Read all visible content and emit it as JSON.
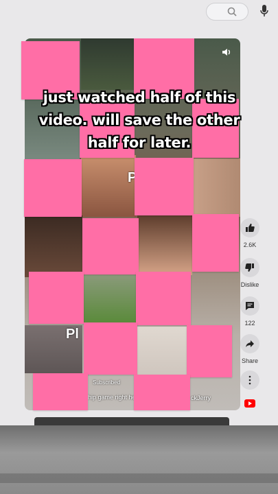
{
  "caption": {
    "line1": "just watched half of this",
    "line2": "video. will save the other",
    "line3": "half for later."
  },
  "video": {
    "subscribed_label": "Subscribed",
    "title_fragment": "hip game right he",
    "channel_fragment": "ckJerry",
    "overlay_letter_1": "P",
    "overlay_letters_2": "Pl"
  },
  "actions": {
    "likes": "2.6K",
    "dislike_label": "Dislike",
    "comments": "122",
    "share_label": "Share"
  },
  "icons": {
    "search": "search-icon",
    "mic": "mic-icon",
    "volume": "volume-icon",
    "like": "thumbs-up-icon",
    "dislike": "thumbs-down-icon",
    "comment": "comment-icon",
    "share": "share-icon",
    "more": "more-vertical-icon",
    "youtube": "youtube-logo-icon"
  },
  "colors": {
    "sticky_note": "#ff6ea6",
    "youtube_red": "#ff0000"
  }
}
